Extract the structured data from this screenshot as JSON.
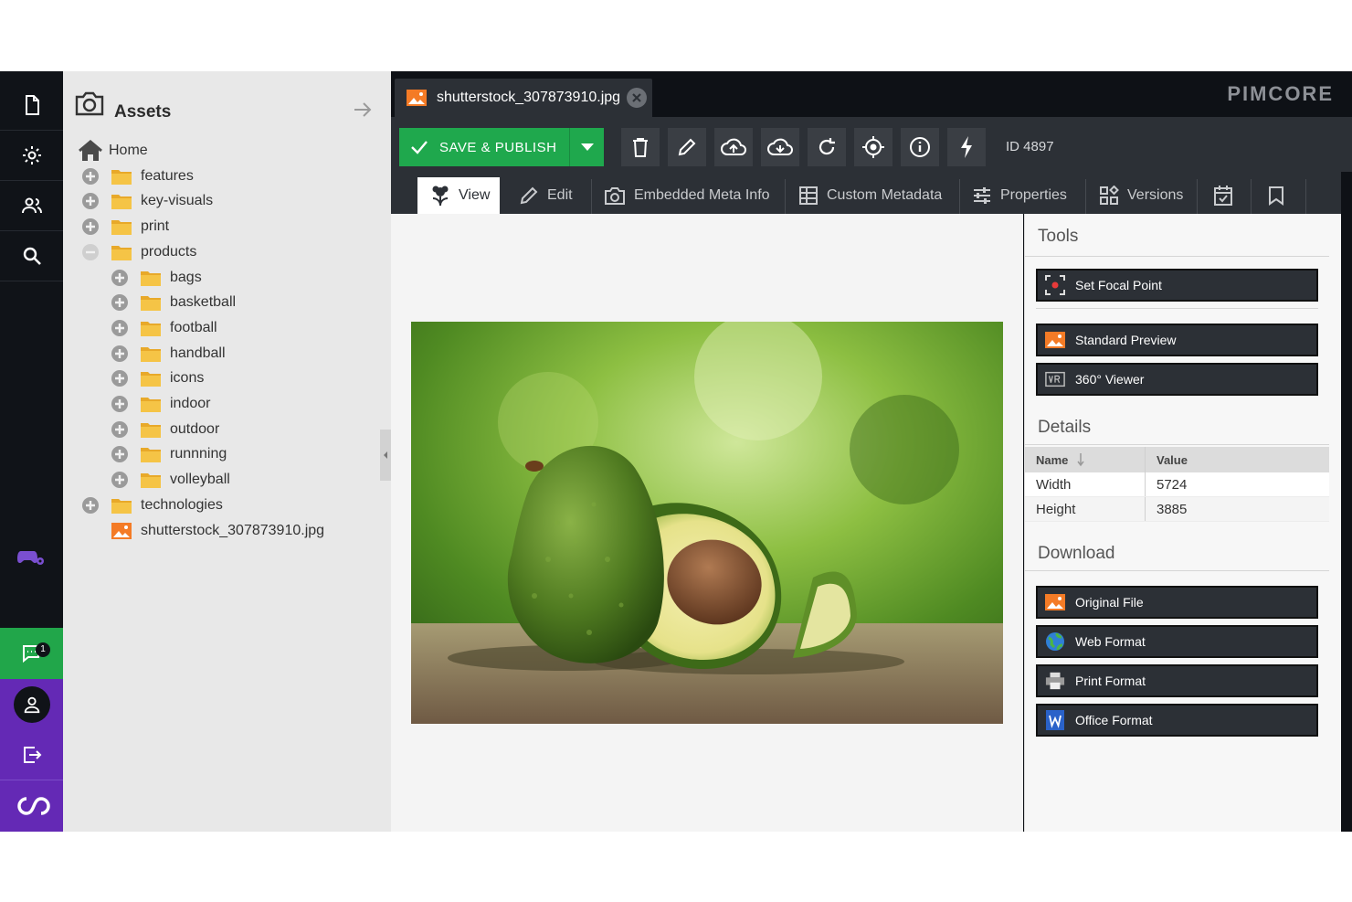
{
  "tree": {
    "title": "Assets",
    "items": [
      {
        "label": "Home",
        "level": 0,
        "kind": "home"
      },
      {
        "label": "features",
        "level": 0,
        "kind": "folder",
        "state": "collapsed"
      },
      {
        "label": "key-visuals",
        "level": 0,
        "kind": "folder",
        "state": "collapsed"
      },
      {
        "label": "print",
        "level": 0,
        "kind": "folder",
        "state": "collapsed"
      },
      {
        "label": "products",
        "level": 0,
        "kind": "folder",
        "state": "expanded"
      },
      {
        "label": "bags",
        "level": 1,
        "kind": "folder",
        "state": "collapsed"
      },
      {
        "label": "basketball",
        "level": 1,
        "kind": "folder",
        "state": "collapsed"
      },
      {
        "label": "football",
        "level": 1,
        "kind": "folder",
        "state": "collapsed"
      },
      {
        "label": "handball",
        "level": 1,
        "kind": "folder",
        "state": "collapsed"
      },
      {
        "label": "icons",
        "level": 1,
        "kind": "folder",
        "state": "collapsed"
      },
      {
        "label": "indoor",
        "level": 1,
        "kind": "folder",
        "state": "collapsed"
      },
      {
        "label": "outdoor",
        "level": 1,
        "kind": "folder",
        "state": "collapsed"
      },
      {
        "label": "runnning",
        "level": 1,
        "kind": "folder",
        "state": "collapsed"
      },
      {
        "label": "volleyball",
        "level": 1,
        "kind": "folder",
        "state": "collapsed"
      },
      {
        "label": "technologies",
        "level": 0,
        "kind": "folder",
        "state": "collapsed"
      },
      {
        "label": "shutterstock_307873910.jpg",
        "level": 0,
        "kind": "image"
      }
    ]
  },
  "rail": {
    "chat_badge": "1"
  },
  "tab": {
    "label": "shutterstock_307873910.jpg"
  },
  "brand": "PIMCORE",
  "toolbar": {
    "save_label": "SAVE & PUBLISH",
    "id_label": "ID 4897"
  },
  "subtabs": {
    "view": "View",
    "edit": "Edit",
    "embedded": "Embedded Meta Info",
    "custom": "Custom Metadata",
    "properties": "Properties",
    "versions": "Versions"
  },
  "side": {
    "tools_title": "Tools",
    "focal_point": "Set Focal Point",
    "standard_preview": "Standard Preview",
    "viewer_360": "360° Viewer",
    "details_title": "Details",
    "details_head": {
      "name": "Name",
      "value": "Value"
    },
    "details_rows": [
      {
        "name": "Width",
        "value": "5724"
      },
      {
        "name": "Height",
        "value": "3885"
      }
    ],
    "download_title": "Download",
    "original_file": "Original File",
    "web_format": "Web Format",
    "print_format": "Print Format",
    "office_format": "Office Format"
  },
  "colors": {
    "accent_green": "#1fa84d",
    "purple": "#6429b5",
    "folder": "#f5c446",
    "image_icon": "#f47b26"
  }
}
